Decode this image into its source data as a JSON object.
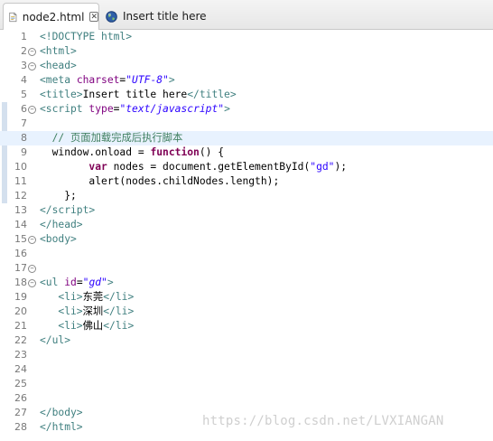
{
  "tabs": [
    {
      "label": "node2.html",
      "icon": "html-file-icon",
      "active": true,
      "close": "✕"
    },
    {
      "label": "Insert title here",
      "icon": "globe-icon",
      "active": false
    }
  ],
  "watermark": "https://blog.csdn.net/LVXIANGAN",
  "lines": [
    {
      "n": "1",
      "fold": false,
      "html": "<span class=\"tg\">&lt;!DOCTYPE html&gt;</span>"
    },
    {
      "n": "2",
      "fold": true,
      "html": "<span class=\"tg\">&lt;html&gt;</span>"
    },
    {
      "n": "3",
      "fold": true,
      "html": "<span class=\"tg\">&lt;head&gt;</span>"
    },
    {
      "n": "4",
      "fold": false,
      "html": "<span class=\"tg\">&lt;meta </span><span class=\"at\">charset</span>=<span class=\"av\">\"UTF-8\"</span><span class=\"tg\">&gt;</span>"
    },
    {
      "n": "5",
      "fold": false,
      "html": "<span class=\"tg\">&lt;title&gt;</span><span class=\"pl\">Insert title here</span><span class=\"tg\">&lt;/title&gt;</span>"
    },
    {
      "n": "6",
      "fold": true,
      "html": "<span class=\"tg\">&lt;script </span><span class=\"at\">type</span>=<span class=\"av\">\"text/javascript\"</span><span class=\"tg\">&gt;</span>"
    },
    {
      "n": "7",
      "fold": false,
      "html": ""
    },
    {
      "n": "8",
      "fold": false,
      "cur": true,
      "html": "  <span class=\"cm\">// 页面加载完成后执行脚本</span>"
    },
    {
      "n": "9",
      "fold": false,
      "html": "  window.onload = <span class=\"kw\">function</span>() {"
    },
    {
      "n": "10",
      "fold": false,
      "html": "        <span class=\"kw\">var</span> nodes = document.getElementById(<span class=\"st\">\"gd\"</span>);"
    },
    {
      "n": "11",
      "fold": false,
      "html": "        alert(nodes.childNodes.length);"
    },
    {
      "n": "12",
      "fold": false,
      "html": "    };"
    },
    {
      "n": "13",
      "fold": false,
      "html": "<span class=\"tg\">&lt;/script&gt;</span>"
    },
    {
      "n": "14",
      "fold": false,
      "html": "<span class=\"tg\">&lt;/head&gt;</span>"
    },
    {
      "n": "15",
      "fold": true,
      "html": "<span class=\"tg\">&lt;body&gt;</span>"
    },
    {
      "n": "16",
      "fold": false,
      "html": ""
    },
    {
      "n": "17",
      "fold": true,
      "html": ""
    },
    {
      "n": "18",
      "fold": true,
      "html": "<span class=\"tg\">&lt;ul </span><span class=\"at\">id</span>=<span class=\"av\">\"gd\"</span><span class=\"tg\">&gt;</span>"
    },
    {
      "n": "19",
      "fold": false,
      "html": "   <span class=\"tg\">&lt;li&gt;</span><span class=\"cn\">东莞</span><span class=\"tg\">&lt;/li&gt;</span>"
    },
    {
      "n": "20",
      "fold": false,
      "html": "   <span class=\"tg\">&lt;li&gt;</span><span class=\"cn\">深圳</span><span class=\"tg\">&lt;/li&gt;</span>"
    },
    {
      "n": "21",
      "fold": false,
      "html": "   <span class=\"tg\">&lt;li&gt;</span><span class=\"cn\">佛山</span><span class=\"tg\">&lt;/li&gt;</span>"
    },
    {
      "n": "22",
      "fold": false,
      "html": "<span class=\"tg\">&lt;/ul&gt;</span>"
    },
    {
      "n": "23",
      "fold": false,
      "html": ""
    },
    {
      "n": "24",
      "fold": false,
      "html": ""
    },
    {
      "n": "25",
      "fold": false,
      "html": ""
    },
    {
      "n": "26",
      "fold": false,
      "html": ""
    },
    {
      "n": "27",
      "fold": false,
      "html": "<span class=\"tg\">&lt;/body&gt;</span>"
    },
    {
      "n": "28",
      "fold": false,
      "html": "<span class=\"tg\">&lt;/html&gt;</span>"
    }
  ]
}
